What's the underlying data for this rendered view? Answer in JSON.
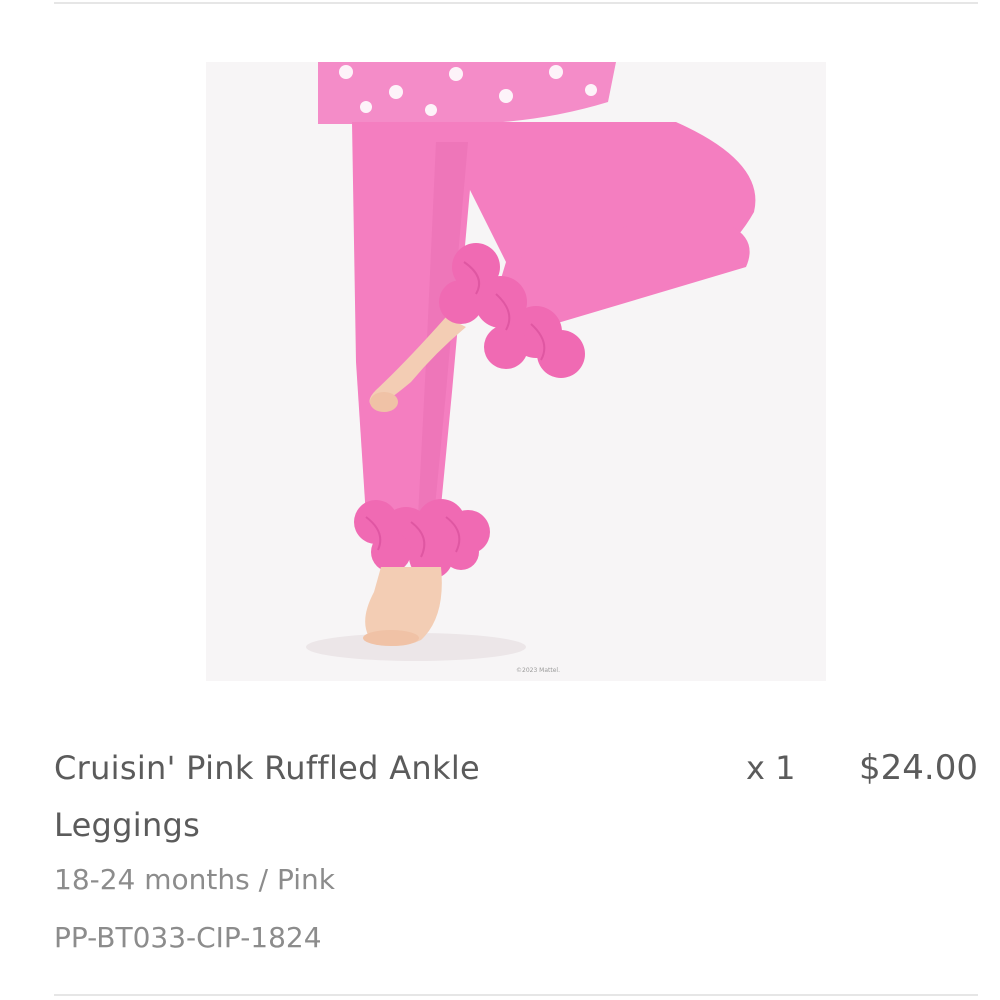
{
  "line_item": {
    "image": {
      "alt": "Cruisin' Pink Ruffled Ankle Leggings product photo",
      "watermark": "©2023 Mattel.",
      "colors": {
        "background": "#f7f5f6",
        "legging": "#f47ec0",
        "ruffle": "#f06ab3",
        "top": "#f48cc8",
        "skin": "#f3cdb4"
      }
    },
    "name": "Cruisin' Pink Ruffled Ankle Leggings",
    "variant": "18-24 months / Pink",
    "sku": "PP-BT033-CIP-1824",
    "quantity": "x 1",
    "price": "$24.00"
  },
  "colors": {
    "text_primary": "#5b5b5b",
    "text_secondary": "#8c8c8c",
    "divider": "#e6e6e6"
  }
}
